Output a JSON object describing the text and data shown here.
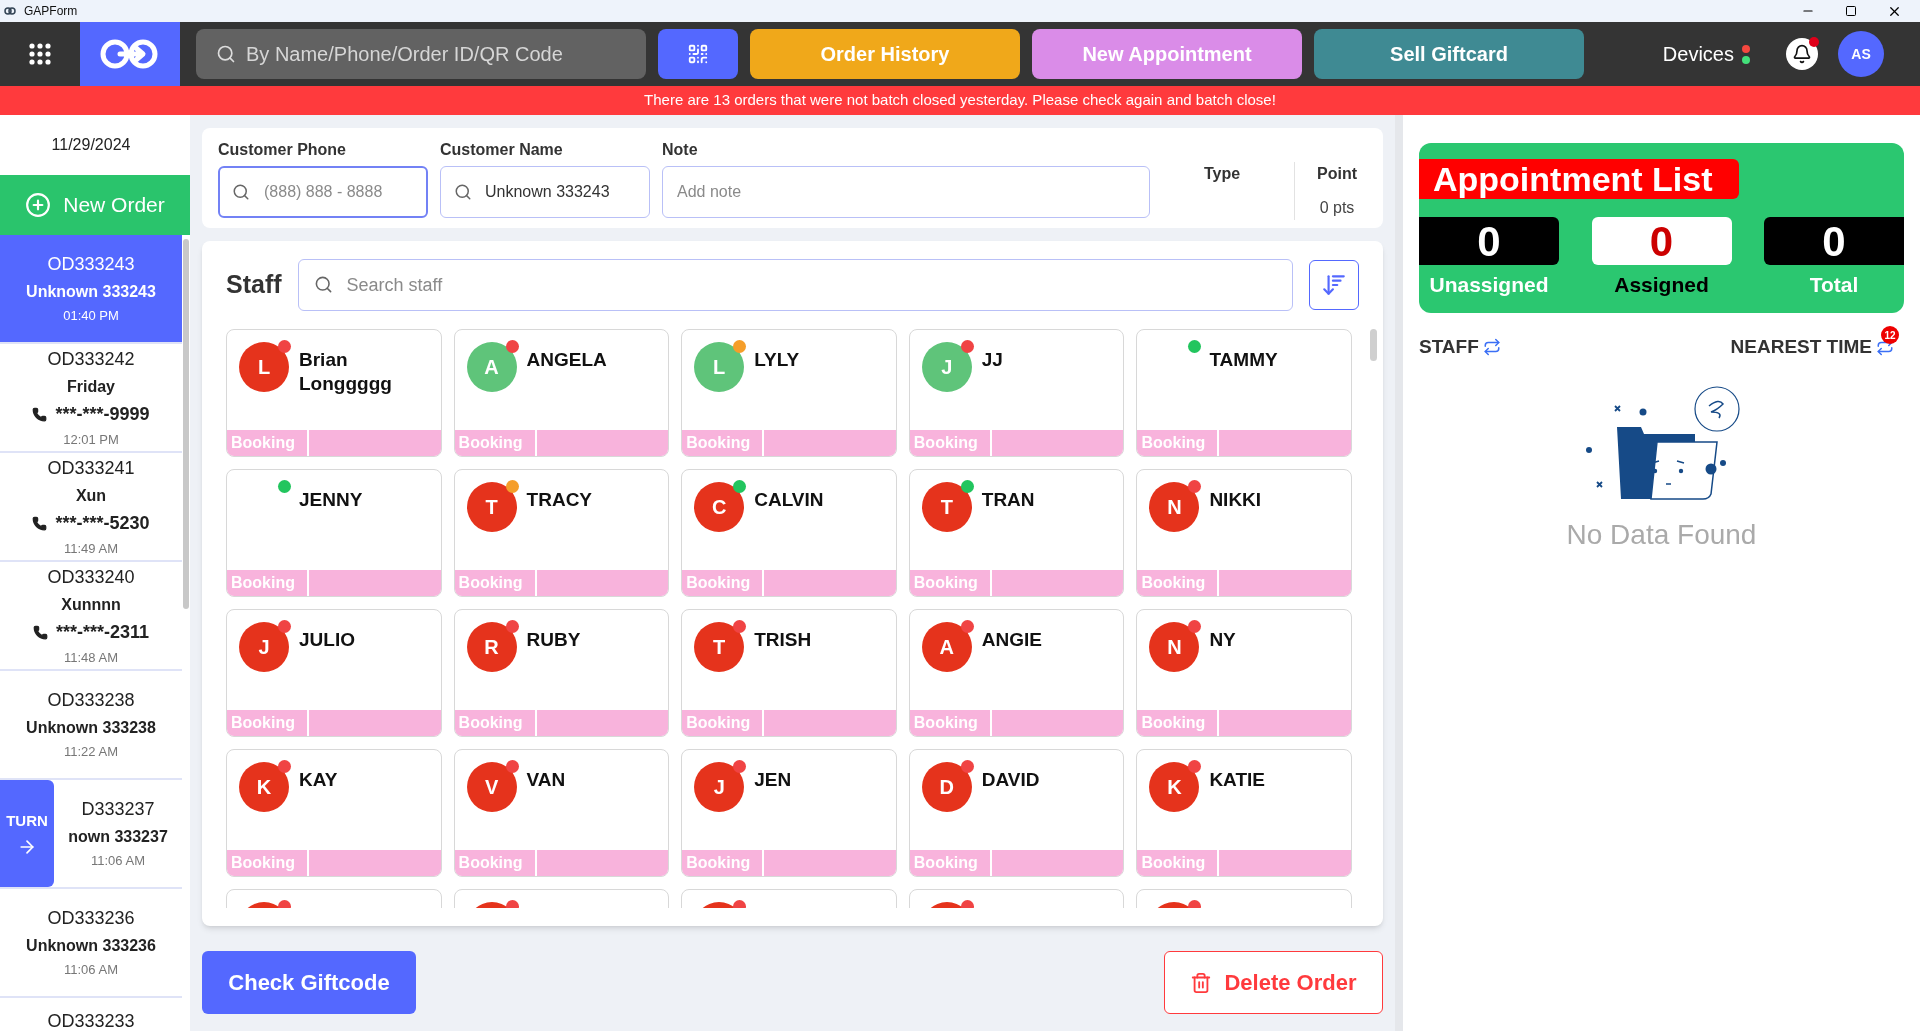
{
  "window": {
    "title": "GAPForm"
  },
  "top_bar": {
    "search": {
      "placeholder": "By Name/Phone/Order ID/QR Code"
    },
    "buttons": [
      {
        "label": "Order History",
        "color": "#f0a81a"
      },
      {
        "label": "New Appointment",
        "color": "#da8ce8"
      },
      {
        "label": "Sell Giftcard",
        "color": "#3f8a93"
      }
    ],
    "devices": {
      "label": "Devices",
      "indicators": [
        {
          "color": "#f5483f"
        },
        {
          "color": "#43e07a"
        }
      ]
    },
    "notifications": {
      "unread": true
    },
    "user": {
      "initials": "AS"
    }
  },
  "banner": "There are 13 orders that were not batch closed yesterday. Please check again and batch close!",
  "sidebar": {
    "date": "11/29/2024",
    "new_order": "New Order",
    "turn_tab": "TURN",
    "orders": [
      {
        "id": "OD333243",
        "name": "Unknown 333243",
        "time": "01:40 PM",
        "selected": true
      },
      {
        "id": "OD333242",
        "name": "Friday",
        "phone": "***-***-9999",
        "time": "12:01 PM",
        "selected": false
      },
      {
        "id": "OD333241",
        "name": "Xun",
        "phone": "***-***-5230",
        "time": "11:49 AM",
        "selected": false
      },
      {
        "id": "OD333240",
        "name": "Xunnnn",
        "phone": "***-***-2311",
        "time": "11:48 AM",
        "selected": false
      },
      {
        "id": "OD333238",
        "name": "Unknown 333238",
        "time": "11:22 AM",
        "selected": false
      },
      {
        "id": "D333237",
        "name": "nown 333237",
        "time": "11:06 AM",
        "selected": false,
        "partly_hidden": true
      },
      {
        "id": "OD333236",
        "name": "Unknown 333236",
        "time": "11:06 AM",
        "selected": false
      },
      {
        "id": "OD333233",
        "selected": false
      }
    ]
  },
  "customer": {
    "phone": {
      "label": "Customer Phone",
      "placeholder": "(888) 888 - 8888",
      "focused": true
    },
    "name": {
      "label": "Customer Name",
      "value": "Unknown 333243",
      "focused": false
    },
    "note": {
      "label": "Note",
      "placeholder": "Add note",
      "focused": false
    },
    "type": {
      "label": "Type"
    },
    "point": {
      "label": "Point",
      "value": "0 pts"
    }
  },
  "staff": {
    "title": "Staff",
    "search_placeholder": "Search staff",
    "members": [
      {
        "name": "Brian Longgggg",
        "avatar": {
          "initial": "L",
          "kind": "filled"
        },
        "color": "#f04444",
        "label": "Booking"
      },
      {
        "name": "ANGELA",
        "avatar": {
          "initial": "A",
          "kind": "pale"
        },
        "color": "#f04444",
        "label": "Booking"
      },
      {
        "name": "LYLY",
        "avatar": {
          "initial": "L",
          "kind": "pale"
        },
        "color": "#f59e2a",
        "label": "Booking"
      },
      {
        "name": "JJ",
        "avatar": {
          "initial": "J",
          "kind": "pale"
        },
        "color": "#f04444",
        "label": "Booking"
      },
      {
        "name": "TAMMY",
        "color": "#22c55e",
        "label": "Booking"
      },
      {
        "name": "JENNY",
        "color": "#22c55e",
        "label": "Booking"
      },
      {
        "name": "TRACY",
        "avatar": {
          "initial": "T",
          "kind": "filled"
        },
        "color": "#f59e2a",
        "label": "Booking"
      },
      {
        "name": "CALVIN",
        "avatar": {
          "initial": "C",
          "kind": "filled"
        },
        "color": "#22c55e",
        "label": "Booking"
      },
      {
        "name": "TRAN",
        "avatar": {
          "initial": "T",
          "kind": "filled"
        },
        "color": "#22c55e",
        "label": "Booking"
      },
      {
        "name": "NIKKI",
        "avatar": {
          "initial": "N",
          "kind": "filled"
        },
        "color": "#f04444",
        "label": "Booking"
      },
      {
        "name": "JULIO",
        "avatar": {
          "initial": "J",
          "kind": "filled"
        },
        "color": "#f04444",
        "label": "Booking"
      },
      {
        "name": "RUBY",
        "avatar": {
          "initial": "R",
          "kind": "filled"
        },
        "color": "#f04444",
        "label": "Booking"
      },
      {
        "name": "TRISH",
        "avatar": {
          "initial": "T",
          "kind": "filled"
        },
        "color": "#f04444",
        "label": "Booking"
      },
      {
        "name": "ANGIE",
        "avatar": {
          "initial": "A",
          "kind": "filled"
        },
        "color": "#f04444",
        "label": "Booking"
      },
      {
        "name": "NY",
        "avatar": {
          "initial": "N",
          "kind": "filled"
        },
        "color": "#f04444",
        "label": "Booking"
      },
      {
        "name": "KAY",
        "avatar": {
          "initial": "K",
          "kind": "filled"
        },
        "color": "#f04444",
        "label": "Booking"
      },
      {
        "name": "VAN",
        "avatar": {
          "initial": "V",
          "kind": "filled"
        },
        "color": "#f04444",
        "label": "Booking"
      },
      {
        "name": "JEN",
        "avatar": {
          "initial": "J",
          "kind": "filled"
        },
        "color": "#f04444",
        "label": "Booking"
      },
      {
        "name": "DAVID",
        "avatar": {
          "initial": "D",
          "kind": "filled"
        },
        "color": "#f04444",
        "label": "Booking"
      },
      {
        "name": "KATIE",
        "avatar": {
          "initial": "K",
          "kind": "filled"
        },
        "color": "#f04444",
        "label": "Booking"
      },
      {
        "avatar": {
          "kind": "filled"
        },
        "color": "#f04444"
      },
      {
        "avatar": {
          "kind": "filled"
        },
        "color": "#f04444"
      },
      {
        "avatar": {
          "kind": "filled"
        },
        "color": "#f04444"
      },
      {
        "avatar": {
          "kind": "filled"
        },
        "color": "#f04444"
      },
      {
        "avatar": {
          "kind": "filled"
        },
        "color": "#f04444"
      }
    ]
  },
  "actions": {
    "check_giftcode": "Check Giftcode",
    "delete_order": "Delete Order"
  },
  "appointments": {
    "title": "Appointment List",
    "counters": [
      {
        "value": "0",
        "label": "Unassigned",
        "kind": "dark"
      },
      {
        "value": "0",
        "label": "Assigned",
        "kind": "light"
      },
      {
        "value": "0",
        "label": "Total",
        "kind": "dark"
      }
    ],
    "staff_sort": "STAFF",
    "time_sort": "NEAREST TIME",
    "time_badge": "12",
    "empty": "No Data Found"
  }
}
